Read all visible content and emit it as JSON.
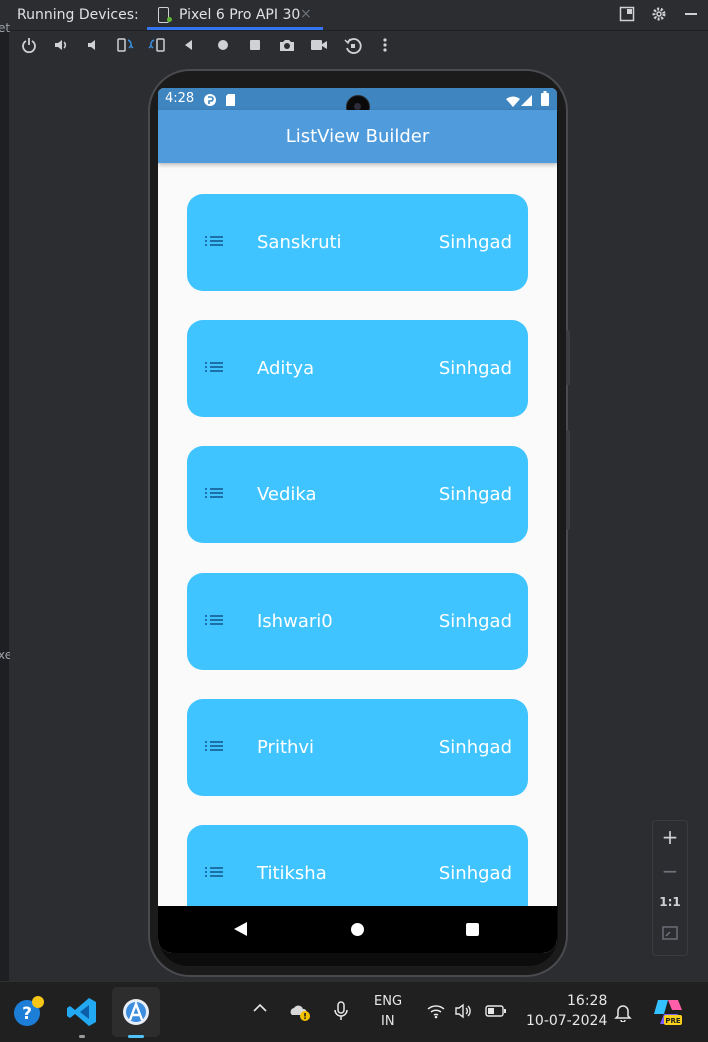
{
  "ide": {
    "panel_title": "Running Devices:",
    "device_tab": "Pixel 6 Pro API 30",
    "tab_close": "×",
    "left_strip_text_top": "et",
    "left_strip_text_mid": "xe"
  },
  "toolbar": {
    "icons": [
      "power-icon",
      "volume-up-icon",
      "volume-down-icon",
      "rotate-left-icon",
      "rotate-right-icon",
      "back-icon",
      "home-icon",
      "overview-icon",
      "screenshot-icon",
      "screen-record-icon",
      "snapshot-icon",
      "more-icon"
    ]
  },
  "device": {
    "status_time": "4:28",
    "app_title": "ListView Builder",
    "items": [
      {
        "name": "Sanskruti",
        "trailing": "Sinhgad"
      },
      {
        "name": "Aditya",
        "trailing": "Sinhgad"
      },
      {
        "name": "Vedika",
        "trailing": "Sinhgad"
      },
      {
        "name": "Ishwari0",
        "trailing": "Sinhgad"
      },
      {
        "name": "Prithvi",
        "trailing": "Sinhgad"
      },
      {
        "name": "Titiksha",
        "trailing": "Sinhgad"
      }
    ],
    "card_color": "#40c4ff",
    "appbar_color": "#4f9bdb"
  },
  "zoom": {
    "zoom_in": "+",
    "zoom_out": "−",
    "actual_size": "1:1"
  },
  "taskbar": {
    "language_line1": "ENG",
    "language_line2": "IN",
    "clock_time": "16:28",
    "clock_date": "10-07-2024"
  }
}
